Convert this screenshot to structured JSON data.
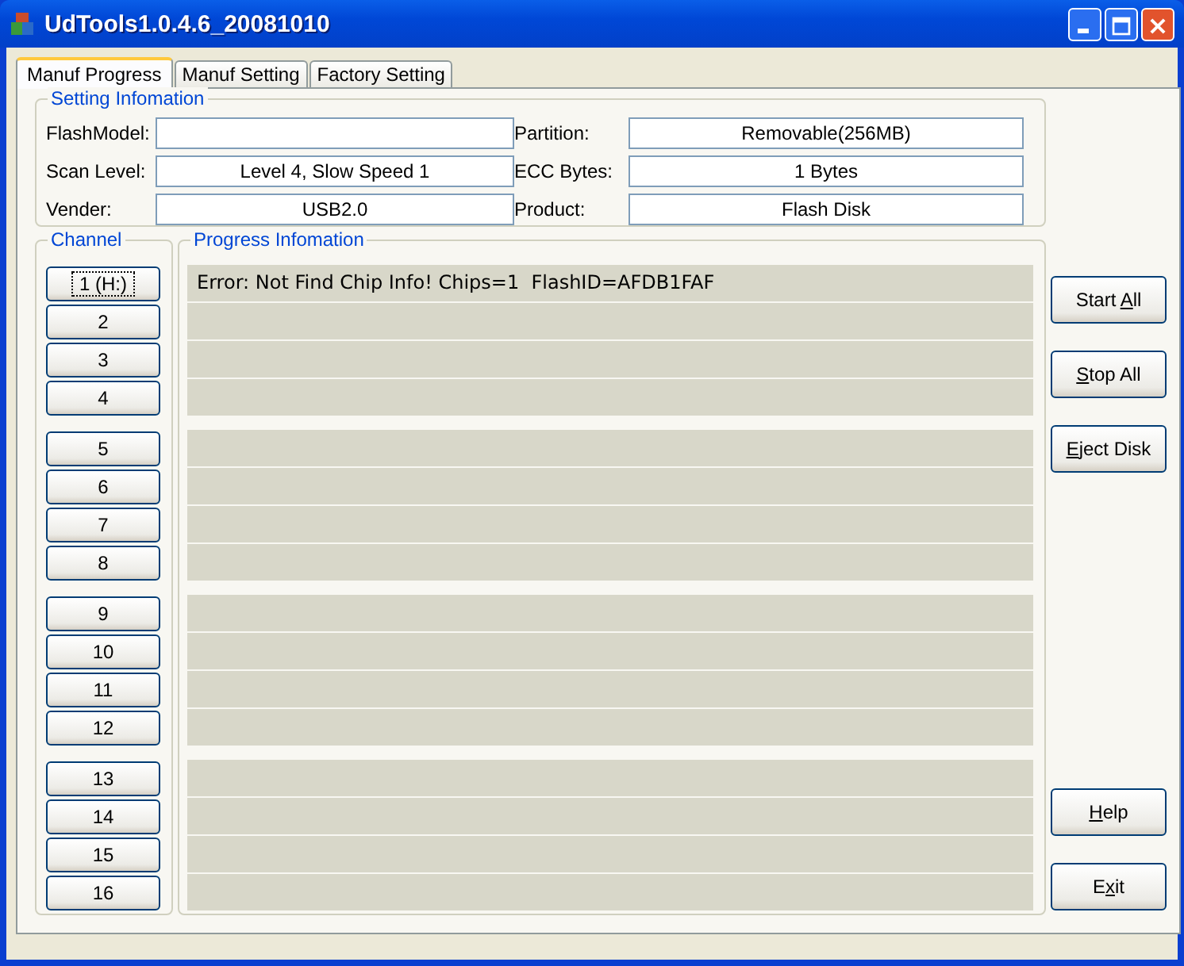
{
  "window": {
    "title": "UdTools1.0.4.6_20081010"
  },
  "tabs": [
    {
      "label": "Manuf Progress",
      "selected": true
    },
    {
      "label": "Manuf Setting",
      "selected": false
    },
    {
      "label": "Factory Setting",
      "selected": false
    }
  ],
  "setting_information": {
    "title": "Setting Infomation",
    "fields": [
      {
        "label": "FlashModel:"
      },
      {
        "label": "Partition:",
        "value": "Removable(256MB)"
      },
      {
        "label": "Scan Level:",
        "value": "Level 4, Slow Speed 1"
      },
      {
        "label": "ECC Bytes:",
        "value": "1 Bytes"
      },
      {
        "label": "Vender:",
        "value": "USB2.0"
      },
      {
        "label": "Product:",
        "value": "Flash Disk"
      }
    ]
  },
  "channel": {
    "title": "Channel"
  },
  "progress_information": {
    "title": "Progress Infomation"
  },
  "channel_groups": [
    {
      "channels": [
        {
          "label": "1 (H:)",
          "focused": true,
          "message": "Error: Not Find Chip Info! Chips=1  FlashID=AFDB1FAF"
        },
        {
          "label": "2",
          "focused": false
        },
        {
          "label": "3",
          "focused": false
        },
        {
          "label": "4",
          "focused": false
        }
      ]
    },
    {
      "channels": [
        {
          "label": "5",
          "focused": false
        },
        {
          "label": "6",
          "focused": false
        },
        {
          "label": "7",
          "focused": false
        },
        {
          "label": "8",
          "focused": false
        }
      ]
    },
    {
      "channels": [
        {
          "label": "9",
          "focused": false
        },
        {
          "label": "10",
          "focused": false
        },
        {
          "label": "11",
          "focused": false
        },
        {
          "label": "12",
          "focused": false
        }
      ]
    },
    {
      "channels": [
        {
          "label": "13",
          "focused": false
        },
        {
          "label": "14",
          "focused": false
        },
        {
          "label": "15",
          "focused": false
        },
        {
          "label": "16",
          "focused": false
        }
      ]
    }
  ],
  "action_buttons": [
    {
      "before": "Start ",
      "access_key": "A",
      "after": "ll",
      "kind": "top"
    },
    {
      "access_key": "S",
      "after": "top All",
      "kind": "top"
    },
    {
      "access_key": "E",
      "after": "ject Disk",
      "kind": "top"
    },
    {
      "access_key": "H",
      "after": "elp",
      "kind": "bottom"
    },
    {
      "before": "E",
      "access_key": "x",
      "after": "it",
      "kind": "bottom"
    }
  ]
}
